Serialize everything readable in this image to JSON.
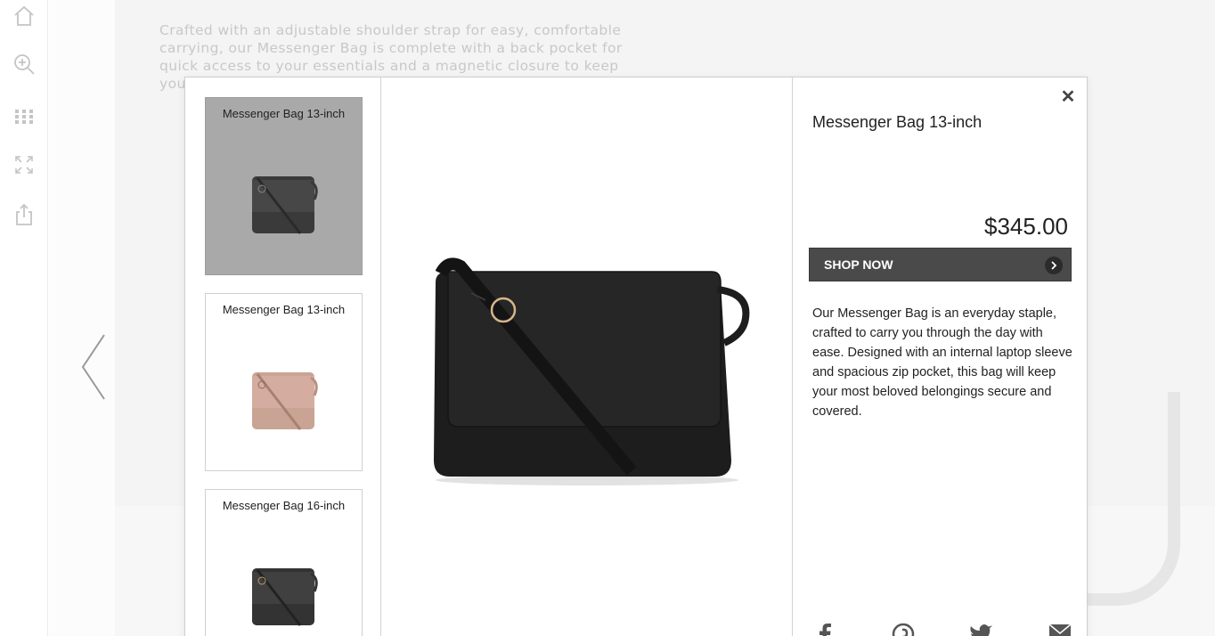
{
  "background": {
    "text": "Crafted with an adjustable shoulder strap for easy, comfortable carrying, our Messenger Bag is complete with a back pocket for quick access to your essentials and a magnetic closure to keep you"
  },
  "thumbnails": [
    {
      "title": "Messenger Bag 13-inch",
      "color": "#3a3a3a"
    },
    {
      "title": "Messenger Bag 13-inch",
      "color": "#c9a394"
    },
    {
      "title": "Messenger Bag 16-inch",
      "color": "#333333"
    }
  ],
  "product": {
    "title": "Messenger Bag 13-inch",
    "price": "$345.00",
    "shop_label": "SHOP NOW",
    "description": "Our Messenger Bag is an everyday staple, crafted to carry you through the day with ease. Designed with an internal laptop sleeve and spacious zip pocket, this bag will keep your most beloved belongings secure and covered."
  },
  "colors": {
    "shop_button": "#4a4a4a",
    "active_thumb": "#a9a9a9"
  },
  "icons": [
    "home-icon",
    "zoom-in-icon",
    "grid-icon",
    "fullscreen-icon",
    "share-icon",
    "chevron-left-icon",
    "close-icon",
    "chevron-right-icon",
    "facebook-icon",
    "pinterest-icon",
    "twitter-icon",
    "email-icon"
  ]
}
